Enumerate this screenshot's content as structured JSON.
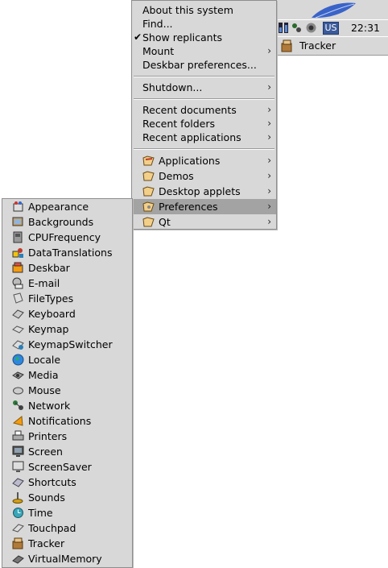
{
  "deskbar": {
    "clock": "22:31",
    "keyboard_layout": "US",
    "tracker_label": "Tracker",
    "logo_color": "#3a63c8"
  },
  "main_menu": {
    "about": "About this system",
    "find": "Find...",
    "show_replicants": "Show replicants",
    "mount": "Mount",
    "deskbar_prefs": "Deskbar preferences...",
    "shutdown": "Shutdown...",
    "recent_documents": "Recent documents",
    "recent_folders": "Recent folders",
    "recent_applications": "Recent applications",
    "applications": "Applications",
    "demos": "Demos",
    "desktop_applets": "Desktop applets",
    "preferences": "Preferences",
    "qt": "Qt",
    "checkmark": "✔",
    "arrow": "›"
  },
  "preferences_menu": {
    "items": [
      "Appearance",
      "Backgrounds",
      "CPUFrequency",
      "DataTranslations",
      "Deskbar",
      "E-mail",
      "FileTypes",
      "Keyboard",
      "Keymap",
      "KeymapSwitcher",
      "Locale",
      "Media",
      "Mouse",
      "Network",
      "Notifications",
      "Printers",
      "Screen",
      "ScreenSaver",
      "Shortcuts",
      "Sounds",
      "Time",
      "Touchpad",
      "Tracker",
      "VirtualMemory"
    ]
  }
}
